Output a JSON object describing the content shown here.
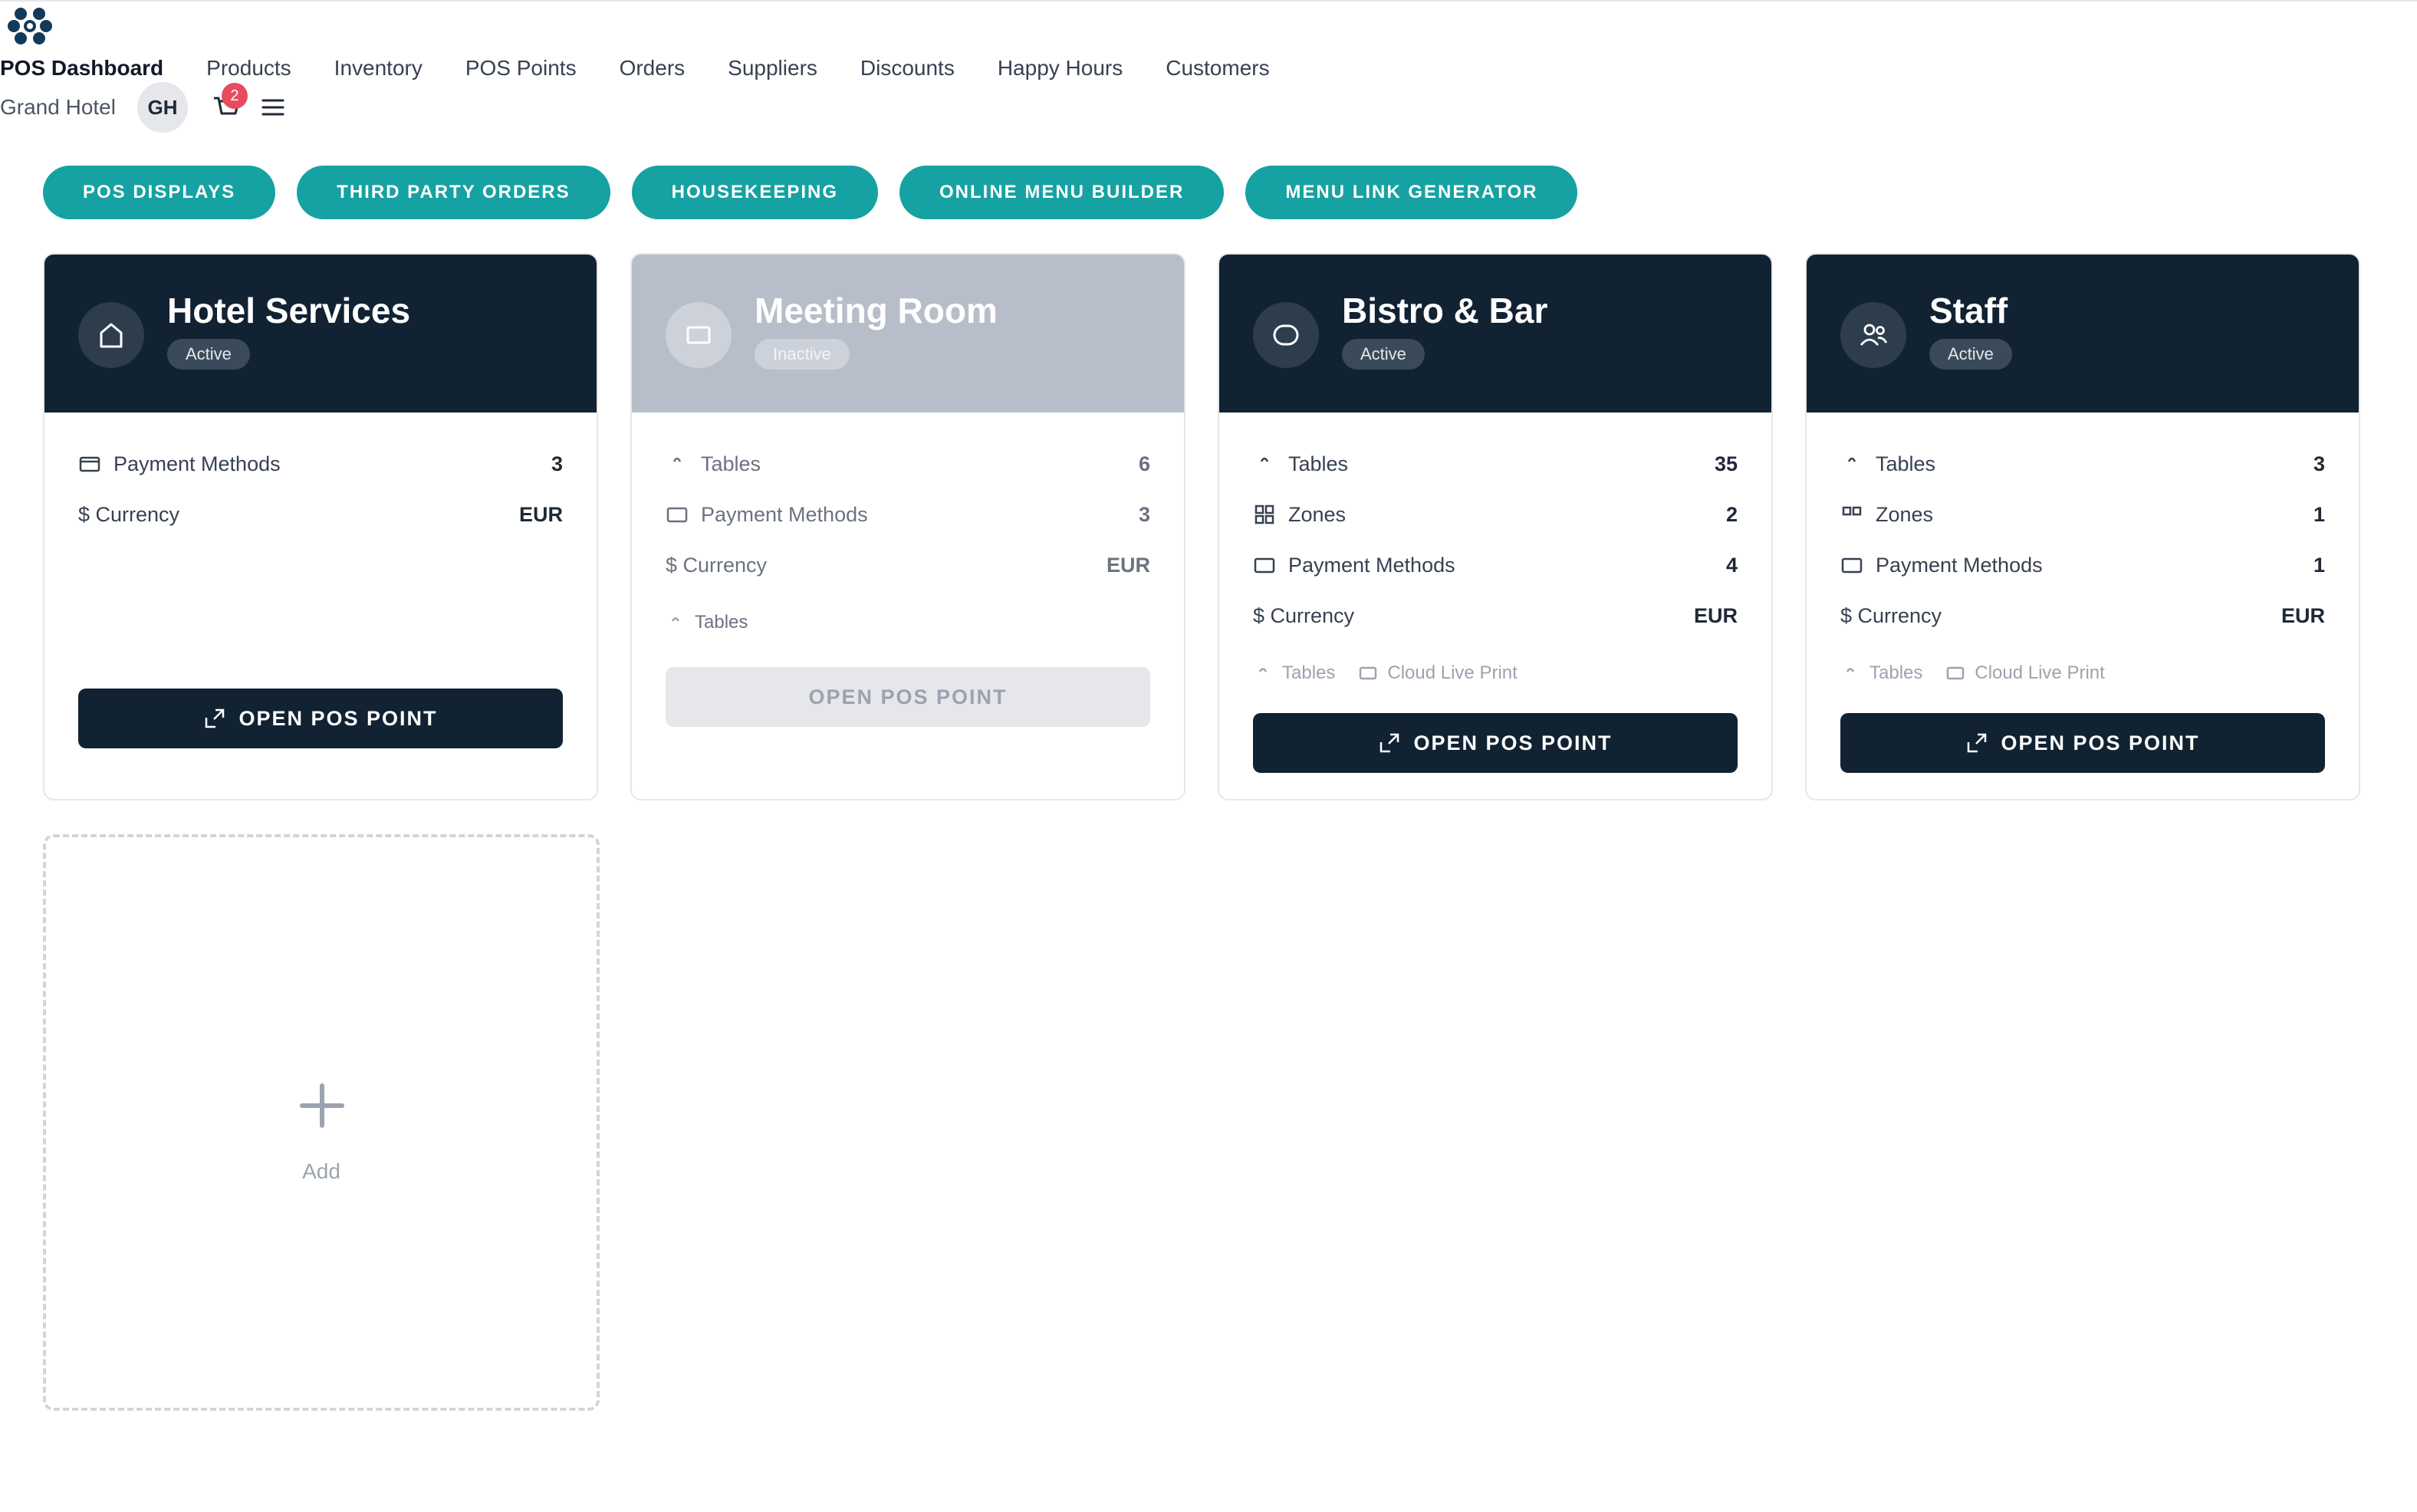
{
  "nav": {
    "items": [
      "POS Dashboard",
      "Products",
      "Inventory",
      "POS Points",
      "Orders",
      "Suppliers",
      "Discounts",
      "Happy Hours",
      "Customers"
    ]
  },
  "user": {
    "hotel": "Grand Hotel",
    "initials": "GH",
    "cart_count": "2"
  },
  "actions": [
    "POS DISPLAYS",
    "THIRD PARTY ORDERS",
    "HOUSEKEEPING",
    "ONLINE MENU BUILDER",
    "MENU LINK GENERATOR"
  ],
  "colors": {
    "accent": "#16a2a2",
    "dark": "#112233",
    "badge": "#e74c5c",
    "inactive": "#b8bec9"
  },
  "cards": [
    {
      "title": "Hotel Services",
      "status": "Active",
      "icon": "home-icon",
      "rows": [
        {
          "label": "Payment Methods",
          "value": "3",
          "icon": "card-icon"
        },
        {
          "label": "$ Currency",
          "value": "EUR"
        }
      ],
      "button": "OPEN POS POINT"
    },
    {
      "title": "Meeting Room",
      "status": "Inactive",
      "icon": "square-icon",
      "rows": [
        {
          "label": "Tables",
          "value": "6",
          "icon": "table-icon"
        },
        {
          "label": "Payment Methods",
          "value": "3",
          "icon": "card-icon"
        },
        {
          "label": "$ Currency",
          "value": "EUR"
        }
      ],
      "footer": [
        "Tables"
      ],
      "button": "OPEN POS POINT"
    },
    {
      "title": "Bistro & Bar",
      "status": "Active",
      "icon": "circle-icon",
      "rows": [
        {
          "label": "Tables",
          "value": "35",
          "icon": "table-icon"
        },
        {
          "label": "Zones",
          "value": "2",
          "icon": "grid-icon"
        },
        {
          "label": "Payment Methods",
          "value": "4",
          "icon": "card-icon"
        },
        {
          "label": "$ Currency",
          "value": "EUR"
        }
      ],
      "footer": [
        "Tables",
        "Cloud Live Print"
      ],
      "button": "OPEN POS POINT"
    },
    {
      "title": "Staff",
      "status": "Active",
      "icon": "users-icon",
      "rows": [
        {
          "label": "Tables",
          "value": "3",
          "icon": "table-icon"
        },
        {
          "label": "Zones",
          "value": "1",
          "icon": "grid-icon"
        },
        {
          "label": "Payment Methods",
          "value": "1",
          "icon": "card-icon"
        },
        {
          "label": "$ Currency",
          "value": "EUR"
        }
      ],
      "footer": [
        "Tables",
        "Cloud Live Print"
      ],
      "button": "OPEN POS POINT"
    }
  ],
  "add_card": {
    "label": "Add"
  }
}
